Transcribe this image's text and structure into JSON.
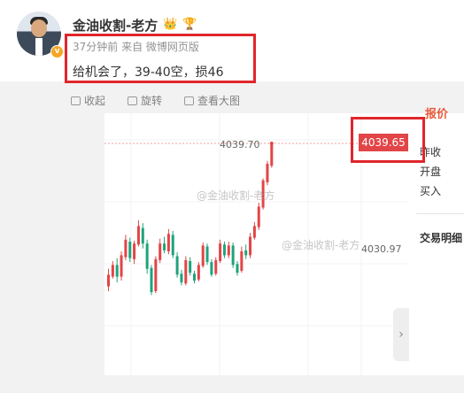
{
  "post": {
    "author": "金油收割-老方",
    "meta": "37分钟前 来自 微博网页版",
    "text": "给机会了，39-40空，损46"
  },
  "toolbar": {
    "collapse": "收起",
    "rotate": "旋转",
    "view_large": "查看大图"
  },
  "chart": {
    "high_label": "4039.70",
    "current_price": "4039.65",
    "mid_price": "4030.97",
    "watermark": "@金油收割-老方"
  },
  "right_panel": {
    "title": "报价",
    "items": [
      "昨收",
      "开盘",
      "买入"
    ],
    "section": "交易明细"
  },
  "colors": {
    "up": "#e24548",
    "down": "#1fa37a",
    "highlight": "#e0262b"
  },
  "chart_data": {
    "type": "candlestick",
    "price_labels": [
      "4039.70",
      "4039.65",
      "4030.97"
    ],
    "last_price": 4039.65,
    "high": 4039.7
  }
}
